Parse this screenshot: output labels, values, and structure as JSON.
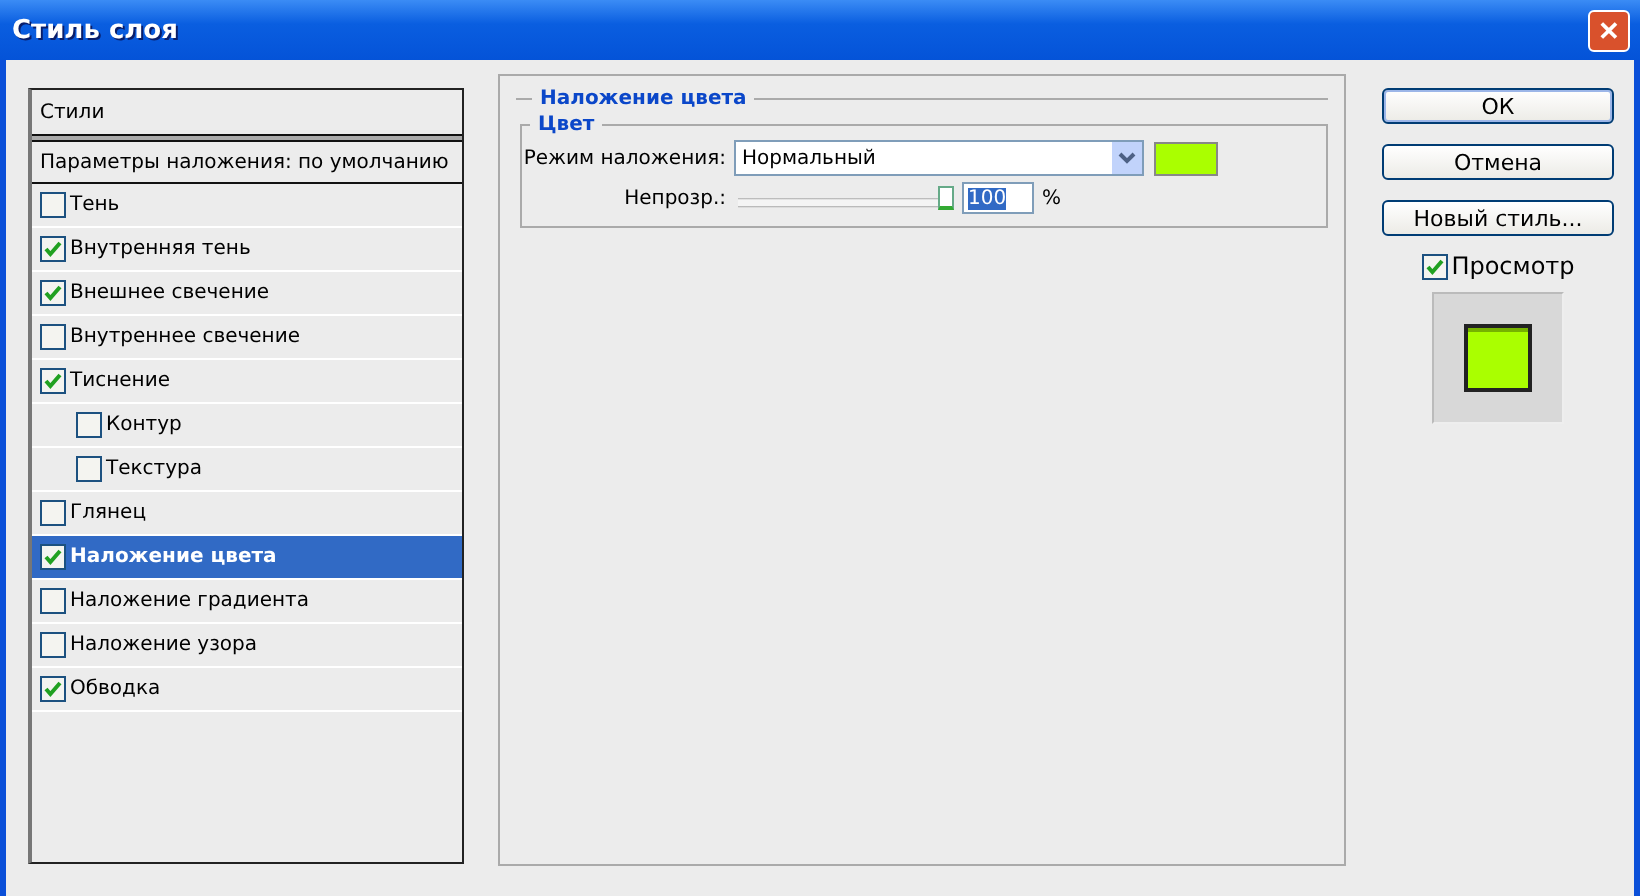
{
  "window": {
    "title": "Стиль слоя",
    "close": "✕"
  },
  "styles_panel": {
    "header": "Стили",
    "defaults": "Параметры наложения: по умолчанию",
    "items": [
      {
        "label": "Тень",
        "checked": false,
        "selected": false
      },
      {
        "label": "Внутренняя тень",
        "checked": true,
        "selected": false
      },
      {
        "label": "Внешнее свечение",
        "checked": true,
        "selected": false
      },
      {
        "label": "Внутреннее свечение",
        "checked": false,
        "selected": false
      },
      {
        "label": "Тиснение",
        "checked": true,
        "selected": false,
        "children": [
          {
            "label": "Контур",
            "checked": false,
            "selected": false
          },
          {
            "label": "Текстура",
            "checked": false,
            "selected": false
          }
        ]
      },
      {
        "label": "Глянец",
        "checked": false,
        "selected": false
      },
      {
        "label": "Наложение цвета",
        "checked": true,
        "selected": true
      },
      {
        "label": "Наложение градиента",
        "checked": false,
        "selected": false
      },
      {
        "label": "Наложение узора",
        "checked": false,
        "selected": false
      },
      {
        "label": "Обводка",
        "checked": true,
        "selected": false
      }
    ]
  },
  "color_overlay": {
    "title": "Наложение цвета",
    "group": "Цвет",
    "blend_label": "Режим наложения:",
    "blend_value": "Нормальный",
    "color": "#aaff00",
    "opacity_label": "Непрозр.:",
    "opacity": {
      "level": 1.0
    },
    "opacity_value": "100",
    "unit": "%"
  },
  "buttons": [
    {
      "label": "ОК",
      "default": true
    },
    {
      "label": "Отмена",
      "default": false
    },
    {
      "label": "Новый стиль...",
      "default": false
    }
  ],
  "preview": {
    "label": "Просмотр",
    "checked": true
  }
}
